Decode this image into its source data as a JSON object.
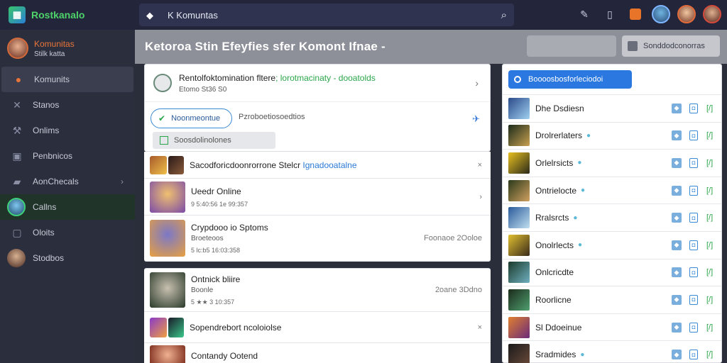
{
  "topbar": {
    "logo_text": "Rostkanalo",
    "search_text": "K Komuntas",
    "icons": [
      "pen-icon",
      "card-icon",
      "box-icon"
    ]
  },
  "sidebar": {
    "user": {
      "name": "Komunitas",
      "sub": "Stilk katta"
    },
    "items": [
      {
        "label": "Komunits",
        "icon": "home-icon",
        "active": true
      },
      {
        "label": "Stanos",
        "icon": "cross-icon"
      },
      {
        "label": "Onlims",
        "icon": "tool-icon"
      },
      {
        "label": "Penbnicos",
        "icon": "box-icon"
      },
      {
        "label": "AonChecals",
        "icon": "gamepad-icon"
      },
      {
        "label": "Callns",
        "avatar": true
      },
      {
        "label": "Oloits",
        "icon": "square-icon"
      },
      {
        "label": "Stodbos",
        "avatar": true
      }
    ]
  },
  "header": {
    "title": "Ketoroa Stin  Efeyfies sfer  Komont Ifnae  -",
    "btn2_label": "Sonddodconorras"
  },
  "top_card": {
    "title": "Rentolfoktomination  fltere",
    "title_green": "; lorotmacinaty  - dooatolds",
    "sub": "Etomo  St36  S0"
  },
  "filters": {
    "pill_label": "Noonmeontue",
    "text": "Pzroboetiosoedtios",
    "pill2_label": "Soosdolinolones"
  },
  "rows": [
    {
      "name": "Sacodforicdoonrorrone  Stelcr",
      "name_blue": " Ignadooatalne",
      "sub": "",
      "meta": "",
      "right": ""
    },
    {
      "name": "Ueedr Online",
      "sub": "",
      "meta": "9  5:40:56  1e 99:357",
      "right": ""
    },
    {
      "name": "Crypdooo io  Sptoms",
      "sub": "Broeteoos",
      "meta": "5  lc:b5  16:03:358",
      "right": "Foonaoe  2Ooloe"
    },
    {
      "name": "Ontnick bliire",
      "sub": "Boonle",
      "meta": "5  ★★ 3  10:357",
      "right": "2oane  3Ddno"
    },
    {
      "name": "Sopendrebort  ncoloiolse",
      "sub": "",
      "meta": "",
      "right": ""
    },
    {
      "name": "Contandy  Ootend",
      "sub": "",
      "meta": "",
      "right": ""
    }
  ],
  "right_panel": {
    "btn_label": "Boooosbosforleciodoi",
    "items": [
      {
        "name": "Dhe Dsdiesn",
        "tag": false
      },
      {
        "name": "Drolrerlaters",
        "tag": true
      },
      {
        "name": "Orlelrsicts",
        "tag": true
      },
      {
        "name": "Ontrielocte",
        "tag": true
      },
      {
        "name": "Rralsrcts",
        "tag": true
      },
      {
        "name": "Onolrlects",
        "tag": true
      },
      {
        "name": "Onlcricdte",
        "tag": false
      },
      {
        "name": "Roorlicne",
        "tag": false
      },
      {
        "name": "Sl Ddoeinue",
        "tag": false
      },
      {
        "name": "Sradmides",
        "tag": true
      }
    ]
  },
  "colors": {
    "accent": "#2b78e0",
    "green": "#4ed36a",
    "orange": "#e8743a"
  }
}
